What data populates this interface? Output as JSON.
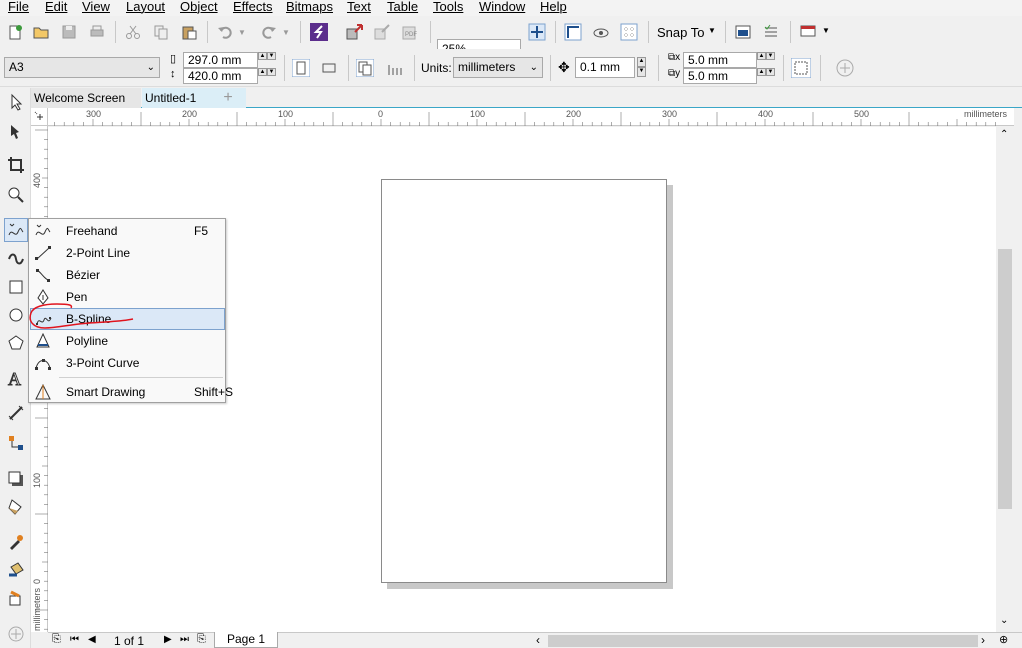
{
  "menu": [
    "File",
    "Edit",
    "View",
    "Layout",
    "Object",
    "Effects",
    "Bitmaps",
    "Text",
    "Table",
    "Tools",
    "Window",
    "Help"
  ],
  "toolbar": {
    "zoom": "25%",
    "snap_to": "Snap To"
  },
  "property_bar": {
    "page_size": "A3",
    "width": "297.0 mm",
    "height": "420.0 mm",
    "units_label": "Units:",
    "units": "millimeters",
    "nudge": "0.1 mm",
    "dup_x": "5.0 mm",
    "dup_y": "5.0 mm"
  },
  "tabs": [
    "Welcome Screen",
    "Untitled-1"
  ],
  "ruler": {
    "h_ticks": [
      "300",
      "200",
      "100",
      "0",
      "100",
      "200",
      "300",
      "400",
      "500"
    ],
    "h_unit": "millimeters",
    "v_ticks": [
      "400",
      "100",
      "0"
    ],
    "v_unit": "millimeters"
  },
  "flyout": {
    "items": [
      {
        "label": "Freehand",
        "shortcut": "F5"
      },
      {
        "label": "2-Point Line",
        "shortcut": ""
      },
      {
        "label": "Bézier",
        "shortcut": ""
      },
      {
        "label": "Pen",
        "shortcut": ""
      },
      {
        "label": "B-Spline",
        "shortcut": ""
      },
      {
        "label": "Polyline",
        "shortcut": ""
      },
      {
        "label": "3-Point Curve",
        "shortcut": ""
      },
      {
        "label": "Smart Drawing",
        "shortcut": "Shift+S"
      }
    ],
    "selected": "B-Spline"
  },
  "status": {
    "page_count": "1 of 1",
    "page_tab": "Page 1"
  },
  "colors": {
    "accent": "#3aa6c7",
    "annotation": "#e0141e",
    "selection": "#dbe8f7"
  }
}
